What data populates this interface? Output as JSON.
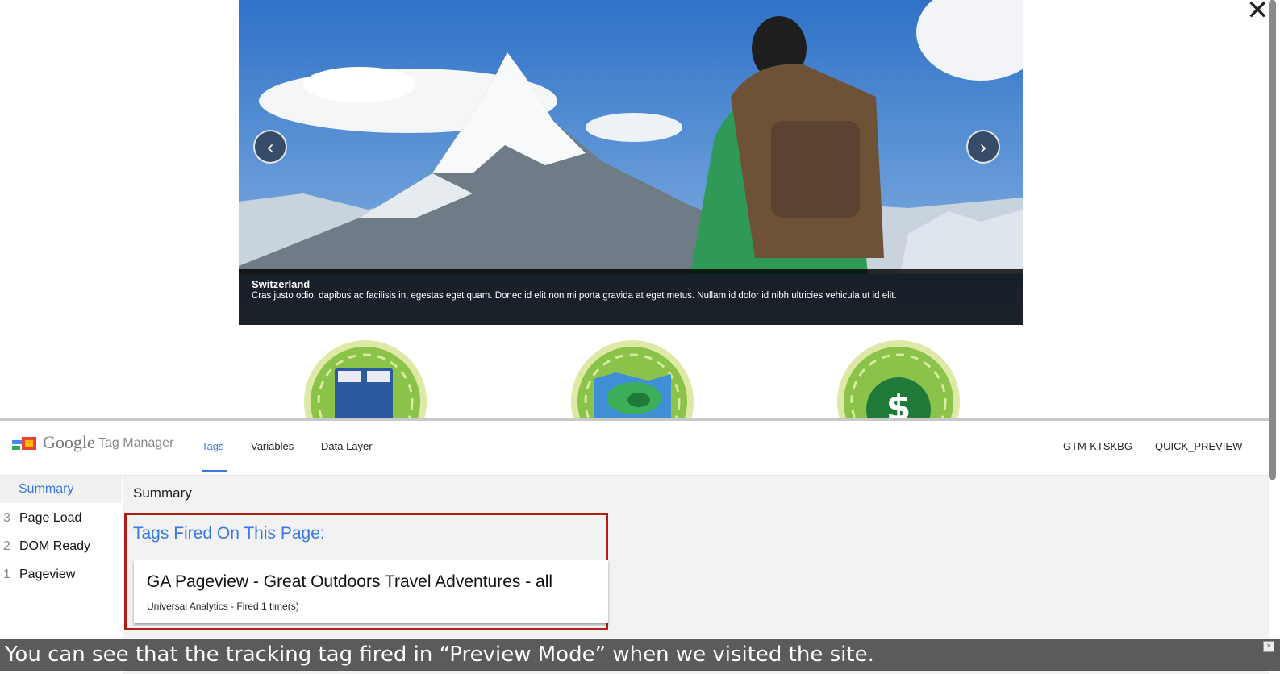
{
  "window": {
    "close_label": "✕"
  },
  "carousel": {
    "prev_label": "‹",
    "next_label": "›",
    "caption_title": "Switzerland",
    "caption_text": "Cras justo odio, dapibus ac facilisis in, egestas eget quam. Donec id elit non mi porta gravida at eget metus. Nullam id dolor id nibh ultricies vehicula ut id elit."
  },
  "features": [
    {
      "icon": "bed-icon"
    },
    {
      "icon": "map-icon"
    },
    {
      "icon": "dollar-icon"
    }
  ],
  "gtm": {
    "brand": "Google",
    "product": "Tag Manager",
    "tabs": [
      {
        "label": "Tags",
        "active": true
      },
      {
        "label": "Variables",
        "active": false
      },
      {
        "label": "Data Layer",
        "active": false
      }
    ],
    "container_id": "GTM-KTSKBG",
    "environment": "QUICK_PREVIEW",
    "sidebar": {
      "summary_label": "Summary",
      "events": [
        {
          "num": "3",
          "label": "Page Load"
        },
        {
          "num": "2",
          "label": "DOM Ready"
        },
        {
          "num": "1",
          "label": "Pageview"
        }
      ]
    },
    "main": {
      "title": "Summary",
      "fired_heading": "Tags Fired On This Page:",
      "tags": [
        {
          "name": "GA Pageview - Great Outdoors Travel Adventures - all",
          "detail": "Universal Analytics - Fired 1 time(s)"
        }
      ]
    }
  },
  "subtitle": "You can see that the tracking tag fired in “Preview Mode” when we visited the site.",
  "colors": {
    "accent": "#3b78e7",
    "highlight": "#b31d12",
    "badge_green": "#8bc34a"
  }
}
